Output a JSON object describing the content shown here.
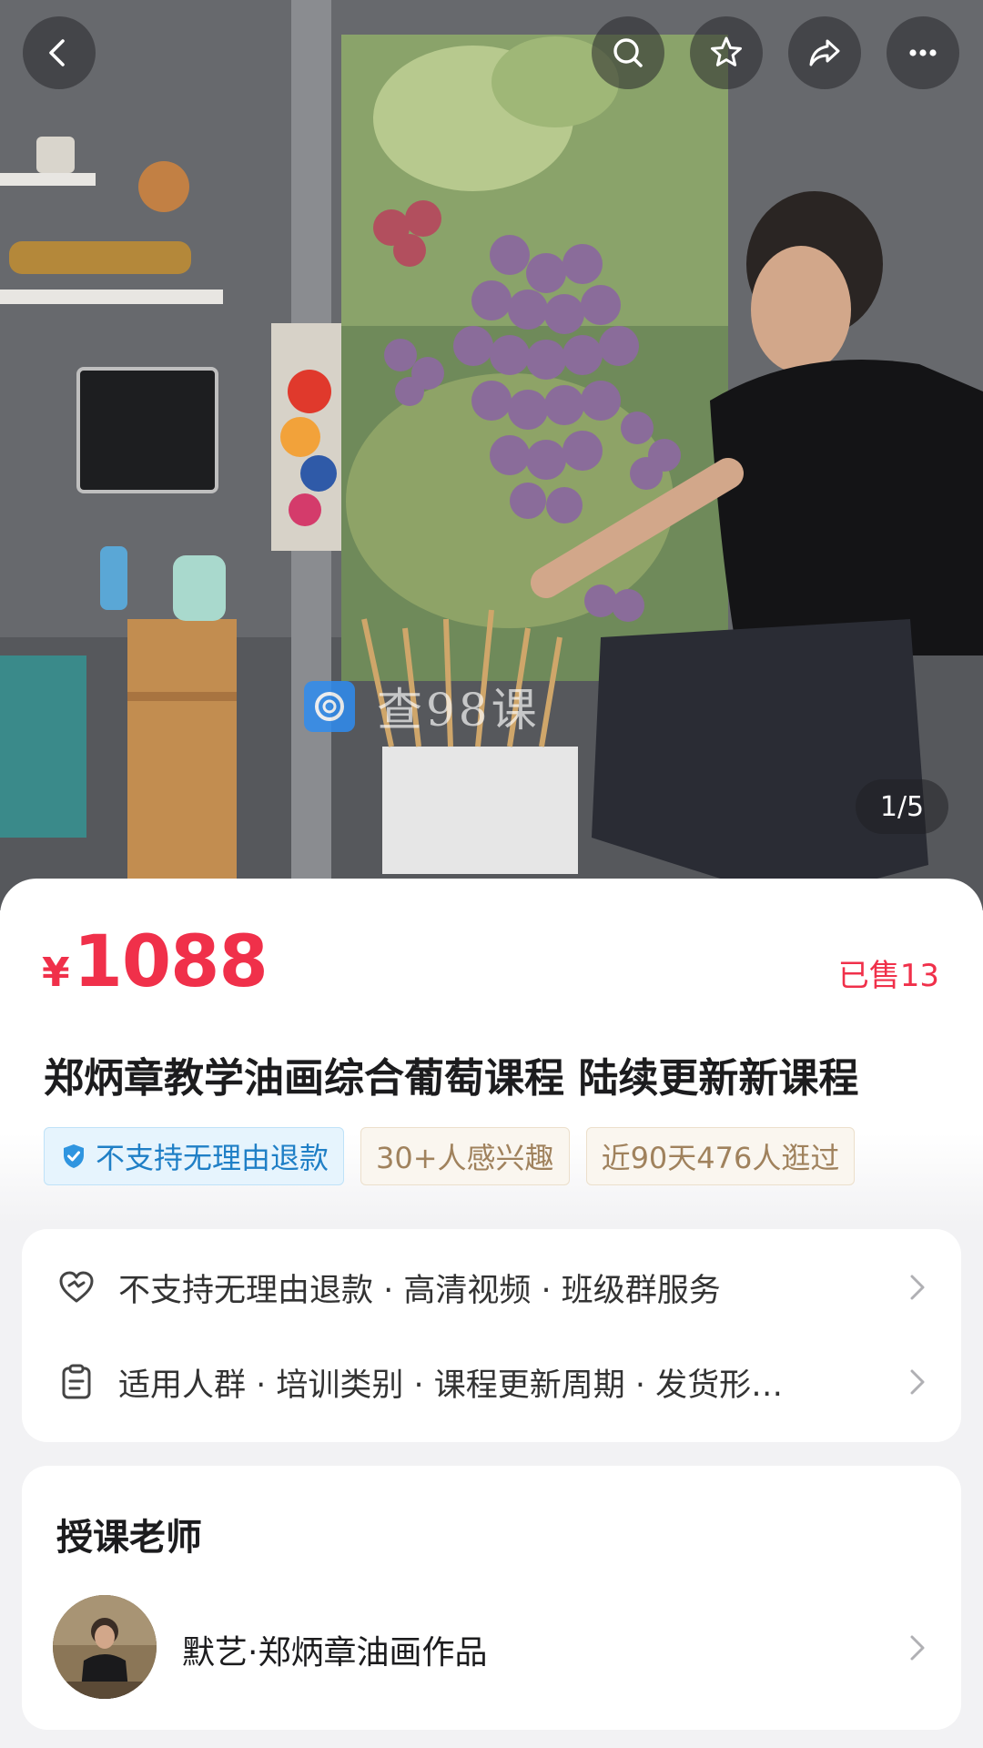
{
  "gallery": {
    "counter": "1/5",
    "watermark_text": "查98课"
  },
  "product": {
    "currency": "¥",
    "price": "1088",
    "sold": "已售13",
    "title": "郑炳章教学油画综合葡萄课程 陆续更新新课程",
    "tags": [
      "不支持无理由退款",
      "30+人感兴趣",
      "近90天476人逛过"
    ]
  },
  "service": {
    "row1": "不支持无理由退款 · 高清视频 · 班级群服务",
    "row2": "适用人群 · 培训类别 · 课程更新周期 · 发货形…"
  },
  "teacher": {
    "heading": "授课老师",
    "name": "默艺·郑炳章油画作品"
  },
  "colors": {
    "price_red": "#f0304a",
    "tag_blue": "#1f7fc6",
    "tag_tan": "#a0825d"
  },
  "icons": [
    "back-icon",
    "search-icon",
    "star-icon",
    "share-icon",
    "more-icon",
    "shield-check-icon",
    "heart-icon",
    "clipboard-icon",
    "chevron-right-icon"
  ]
}
